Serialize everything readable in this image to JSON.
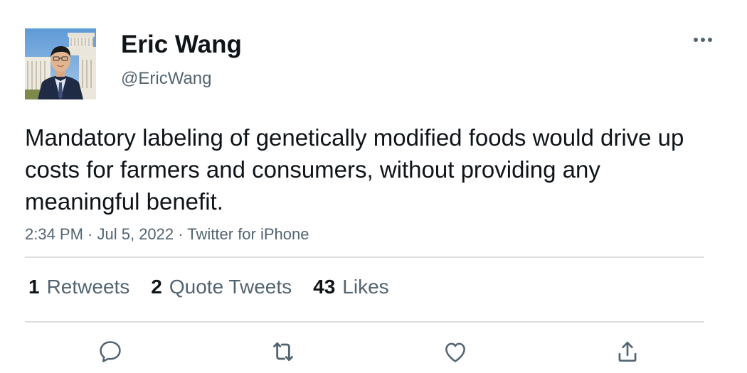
{
  "author": {
    "name": "Eric Wang",
    "handle": "@EricWang"
  },
  "tweet": {
    "text": "Mandatory labeling of genetically modified foods would drive up costs for farmers and consumers, without providing any meaningful benefit.",
    "time": "2:34 PM",
    "separator": " · ",
    "date": "Jul 5, 2022",
    "source": "Twitter for iPhone"
  },
  "stats": {
    "retweets_count": "1",
    "retweets_label": "Retweets",
    "quotes_count": "2",
    "quotes_label": "Quote Tweets",
    "likes_count": "43",
    "likes_label": "Likes"
  },
  "icons": {
    "more": "more-horizontal-icon",
    "reply": "reply-icon",
    "retweet": "retweet-icon",
    "like": "heart-icon",
    "share": "share-icon"
  },
  "colors": {
    "text_primary": "#0f1419",
    "text_secondary": "#536471",
    "divider": "#dcdfe2"
  }
}
